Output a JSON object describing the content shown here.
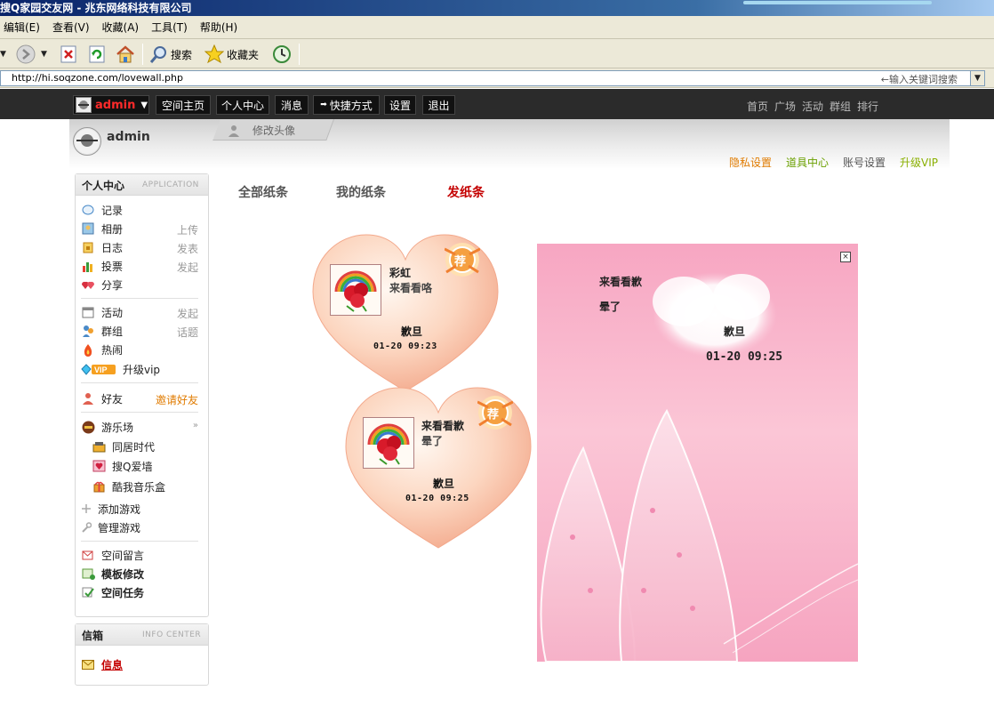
{
  "browser": {
    "title": "搜Q家园交友网 - 兆东网络科技有限公司",
    "menu": [
      "编辑(E)",
      "查看(V)",
      "收藏(A)",
      "工具(T)",
      "帮助(H)"
    ],
    "toolbar": {
      "search_label": "搜索",
      "favorites_label": "收藏夹"
    },
    "address": "http://hi.soqzone.com/lovewall.php",
    "search_hint": "←输入关键词搜索"
  },
  "sitenav": {
    "user": "admin",
    "buttons": [
      "空间主页",
      "个人中心",
      "消息",
      "快捷方式",
      "设置",
      "退出"
    ],
    "right_links": [
      "首页",
      "广场",
      "活动",
      "群组",
      "排行"
    ]
  },
  "profile": {
    "name": "admin",
    "edit_avatar": "修改头像",
    "links": [
      {
        "label": "隐私设置",
        "color": "#e07b00"
      },
      {
        "label": "道具中心",
        "color": "#6aa000"
      },
      {
        "label": "账号设置",
        "color": "#555555"
      },
      {
        "label": "升级VIP",
        "color": "#8ab000"
      }
    ]
  },
  "sidebar": {
    "title": "个人中心",
    "subtitle": "APPLICATION",
    "items": {
      "record": {
        "label": "记录",
        "action": ""
      },
      "album": {
        "label": "相册",
        "action": "上传"
      },
      "blog": {
        "label": "日志",
        "action": "发表"
      },
      "vote": {
        "label": "投票",
        "action": "发起"
      },
      "share": {
        "label": "分享",
        "action": ""
      },
      "event": {
        "label": "活动",
        "action": "发起"
      },
      "group": {
        "label": "群组",
        "action": "话题"
      },
      "hot": {
        "label": "热闹",
        "action": ""
      },
      "vip": {
        "label": "升级vip",
        "action": ""
      },
      "friends": {
        "label": "好友",
        "action": "邀请好友"
      },
      "games": {
        "label": "游乐场"
      },
      "game1": {
        "label": "同居时代"
      },
      "game2": {
        "label": "搜Q爱墙"
      },
      "game3": {
        "label": "酷我音乐盒"
      },
      "add_game": {
        "label": "添加游戏"
      },
      "manage_game": {
        "label": "管理游戏"
      },
      "guestbook": {
        "label": "空间留言"
      },
      "template": {
        "label": "模板修改"
      },
      "tasks": {
        "label": "空间任务"
      }
    }
  },
  "inbox": {
    "title": "信箱",
    "subtitle": "INFO CENTER",
    "link": "信息"
  },
  "tabs": {
    "all": "全部纸条",
    "mine": "我的纸条",
    "send": "发纸条"
  },
  "notes": [
    {
      "title": "彩虹",
      "body": "来看看咯",
      "sign": "歉旦",
      "time": "01-20 09:23",
      "badge": "荐"
    },
    {
      "title": "来看看歉",
      "body": "晕了",
      "sign": "歉旦",
      "time": "01-20 09:25",
      "badge": "荐"
    }
  ],
  "preview": {
    "close": "×",
    "title": "来看看歉",
    "body": "晕了",
    "sign": "歉旦",
    "time": "01-20 09:25"
  }
}
